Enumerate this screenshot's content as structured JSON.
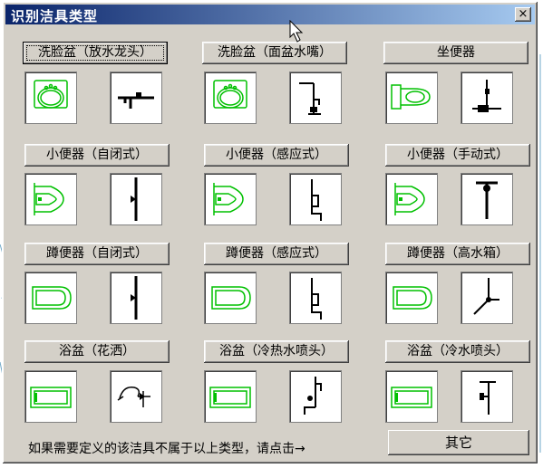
{
  "dialog": {
    "title": "识别洁具类型",
    "close_glyph": "×"
  },
  "fixtures": [
    {
      "label": "洗脸盆（放水龙头）",
      "plan_icon": "washbasin-plan-icon",
      "system_icon": "faucet-system-icon"
    },
    {
      "label": "洗脸盆（面盆水嘴）",
      "plan_icon": "washbasin-plan-icon",
      "system_icon": "basin-tap-system-icon"
    },
    {
      "label": "坐便器",
      "plan_icon": "toilet-plan-icon",
      "system_icon": "toilet-system-icon"
    },
    {
      "label": "小便器（自闭式）",
      "plan_icon": "urinal-plan-icon",
      "system_icon": "urinal-selfclosing-system-icon"
    },
    {
      "label": "小便器（感应式）",
      "plan_icon": "urinal-plan-icon",
      "system_icon": "urinal-sensor-system-icon"
    },
    {
      "label": "小便器（手动式）",
      "plan_icon": "urinal-plan-icon",
      "system_icon": "urinal-manual-system-icon"
    },
    {
      "label": "蹲便器（自闭式）",
      "plan_icon": "squat-toilet-plan-icon",
      "system_icon": "squat-selfclosing-system-icon"
    },
    {
      "label": "蹲便器（感应式）",
      "plan_icon": "squat-toilet-plan-icon",
      "system_icon": "squat-sensor-system-icon"
    },
    {
      "label": "蹲便器（高水箱）",
      "plan_icon": "squat-toilet-plan-icon",
      "system_icon": "squat-hightank-system-icon"
    },
    {
      "label": "浴盆（花洒）",
      "plan_icon": "bathtub-plan-icon",
      "system_icon": "shower-system-icon"
    },
    {
      "label": "浴盆（冷热水喷头）",
      "plan_icon": "bathtub-plan-icon",
      "system_icon": "hot-cold-spray-system-icon"
    },
    {
      "label": "浴盆（冷水喷头）",
      "plan_icon": "bathtub-plan-icon",
      "system_icon": "cold-spray-system-icon"
    }
  ],
  "footer": {
    "prompt": "如果需要定义的该洁具不属于以上类型，请点击→",
    "other_label": "其它"
  },
  "colors": {
    "plan_icon": "#00c000",
    "system_icon": "#000000",
    "titlebar_start": "#0a246a",
    "titlebar_end": "#a6caf0"
  }
}
